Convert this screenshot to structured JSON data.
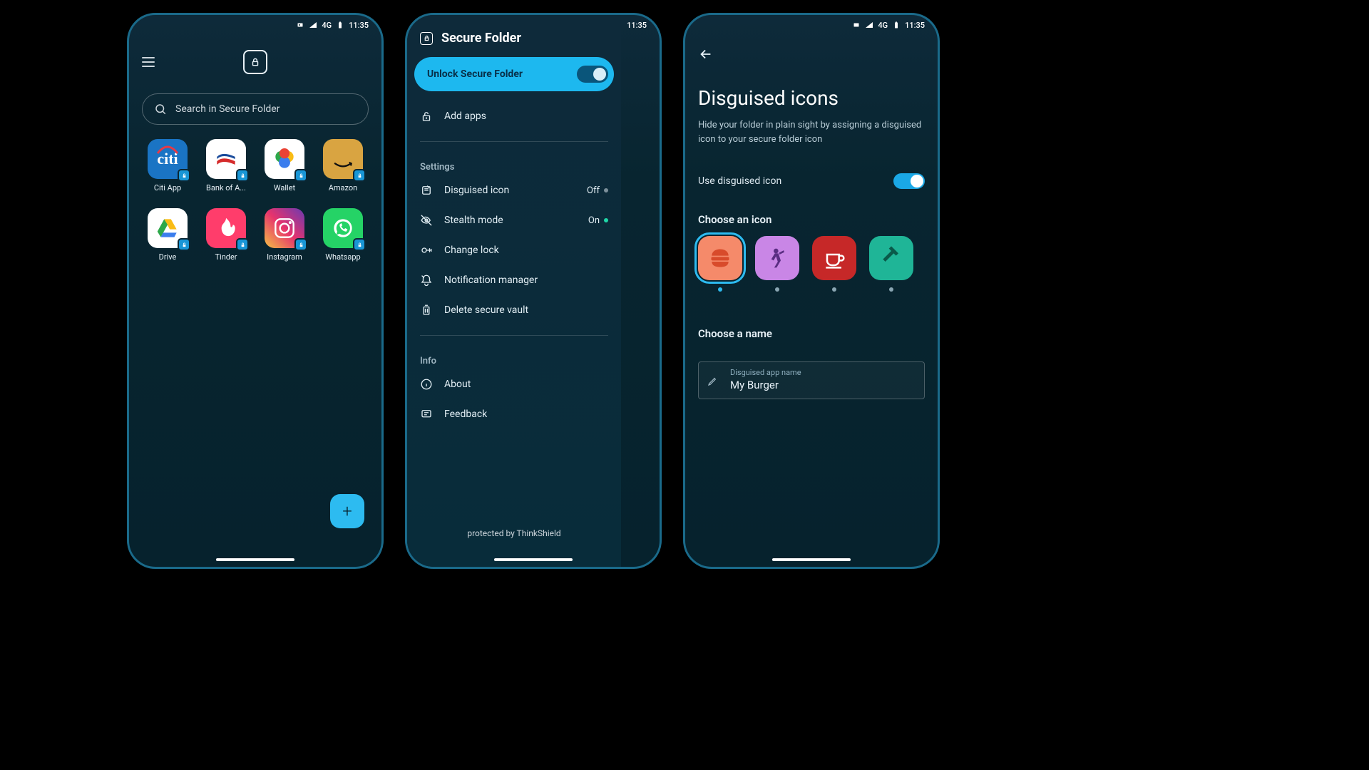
{
  "status": {
    "time": "11:35",
    "net": "4G"
  },
  "s1": {
    "search_placeholder": "Search in Secure Folder",
    "apps": [
      {
        "label": "Citi App",
        "bg": "#1a74c4",
        "kind": "citi"
      },
      {
        "label": "Bank of A...",
        "bg": "#ffffff",
        "kind": "bofa"
      },
      {
        "label": "Wallet",
        "bg": "#ffffff",
        "kind": "wallet"
      },
      {
        "label": "Amazon",
        "bg": "#d9a441",
        "kind": "amazon"
      },
      {
        "label": "Drive",
        "bg": "#ffffff",
        "kind": "drive"
      },
      {
        "label": "Tinder",
        "bg": "#ff3d6b",
        "kind": "tinder"
      },
      {
        "label": "Instagram",
        "bg": "linear-gradient(45deg,#f5c145,#e6336d,#6a3ab2)",
        "kind": "instagram"
      },
      {
        "label": "Whatsapp",
        "bg": "#25d366",
        "kind": "whatsapp"
      }
    ]
  },
  "s2": {
    "title": "Secure Folder",
    "unlock_label": "Unlock Secure Folder",
    "add_apps": "Add apps",
    "settings_label": "Settings",
    "items": [
      {
        "label": "Disguised icon",
        "right": "Off",
        "dot": "#7d909b"
      },
      {
        "label": "Stealth mode",
        "right": "On",
        "dot": "#1fd8a8"
      },
      {
        "label": "Change lock"
      },
      {
        "label": "Notification manager"
      },
      {
        "label": "Delete secure vault"
      }
    ],
    "info_label": "Info",
    "about": "About",
    "feedback": "Feedback",
    "footer": "protected by ThinkShield"
  },
  "s3": {
    "title": "Disguised icons",
    "subtitle": "Hide your folder in plain sight by assigning a disguised icon to your secure folder icon",
    "use_label": "Use disguised icon",
    "choose_icon": "Choose an icon",
    "choose_name": "Choose a name",
    "field_label": "Disguised app name",
    "field_value": "My Burger",
    "options": [
      {
        "bg": "#f58a6a",
        "kind": "burger",
        "selected": true
      },
      {
        "bg": "#c986e6",
        "kind": "dance"
      },
      {
        "bg": "#c62828",
        "kind": "coffee"
      },
      {
        "bg": "#1fb597",
        "kind": "hammer"
      }
    ]
  }
}
